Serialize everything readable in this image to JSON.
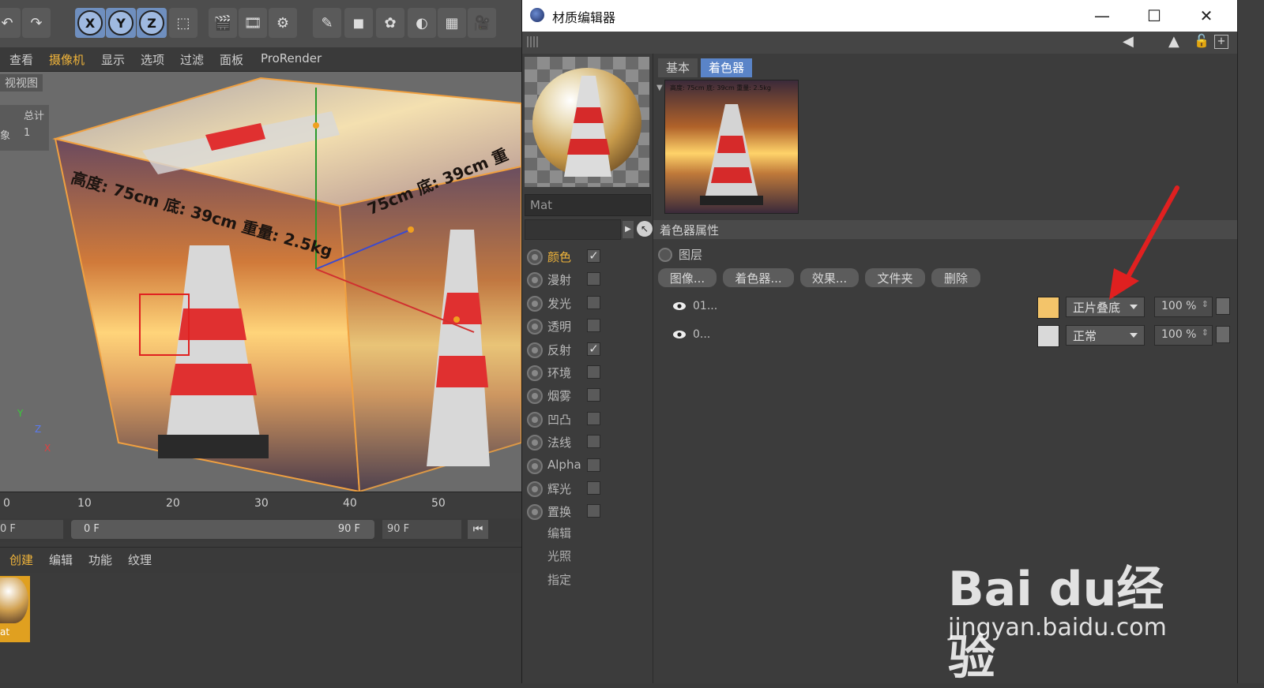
{
  "main": {
    "axis_buttons": [
      "X",
      "Y",
      "Z"
    ],
    "menu": [
      "查看",
      "摄像机",
      "显示",
      "选项",
      "过滤",
      "面板",
      "ProRender"
    ],
    "viewport_label": "视视图",
    "stats": {
      "label": "总计",
      "row_label": "象",
      "row_value": "1"
    },
    "cube_text_front": "高度: 75cm 底: 39cm 重量: 2.5kg",
    "cube_text_side": "75cm 底: 39cm 重",
    "axis_gizmo": [
      "Y",
      "Z",
      "X"
    ],
    "timeline_ticks": [
      "0",
      "10",
      "20",
      "30",
      "40",
      "50"
    ],
    "frames": {
      "start": "0 F",
      "range_start": "0 F",
      "range_end": "90 F",
      "end": "90 F"
    },
    "mat_menu": [
      "创建",
      "编辑",
      "功能",
      "纹理"
    ],
    "mat_thumb_label": "at"
  },
  "editor": {
    "title": "材质编辑器",
    "window_controls": {
      "minimize": "—",
      "maximize": "☐",
      "close": "✕"
    },
    "material_name": "Mat",
    "channels": [
      {
        "label": "颜色",
        "checked": "✓",
        "active": true
      },
      {
        "label": "漫射",
        "checked": ""
      },
      {
        "label": "发光",
        "checked": ""
      },
      {
        "label": "透明",
        "checked": ""
      },
      {
        "label": "反射",
        "checked": "✓"
      },
      {
        "label": "环境",
        "checked": ""
      },
      {
        "label": "烟雾",
        "checked": ""
      },
      {
        "label": "凹凸",
        "checked": ""
      },
      {
        "label": "法线",
        "checked": ""
      },
      {
        "label": "Alpha",
        "checked": ""
      },
      {
        "label": "辉光",
        "checked": ""
      },
      {
        "label": "置换",
        "checked": ""
      }
    ],
    "sub_items": [
      "编辑",
      "光照",
      "指定"
    ],
    "tabs": [
      "基本",
      "着色器"
    ],
    "preview_caption": "高度: 75cm 底: 39cm 重量: 2.5kg",
    "section_title": "着色器属性",
    "layer_label": "图层",
    "buttons": [
      "图像...",
      "着色器...",
      "效果...",
      "文件夹",
      "删除"
    ],
    "layers": [
      {
        "name": "01...",
        "blend": "正片叠底",
        "percent": "100 %",
        "thumb_color": "#f3c46a"
      },
      {
        "name": "0...",
        "blend": "正常",
        "percent": "100 %",
        "thumb_color": "#d9d9d9"
      }
    ],
    "accent_color": "#5a84c8",
    "highlight_color": "#e02020"
  },
  "watermark": {
    "logo": "Bai du经验",
    "url": "jingyan.baidu.com"
  }
}
